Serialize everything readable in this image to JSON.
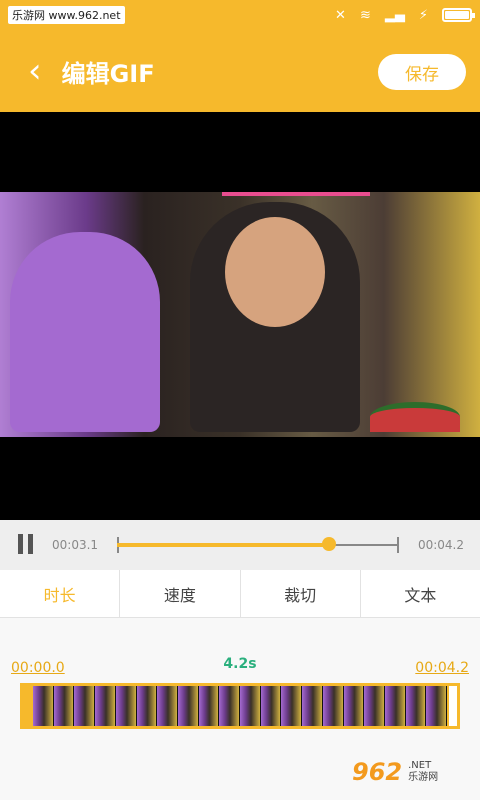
{
  "statusbar": {
    "watermark": "乐游网 www.962.net"
  },
  "header": {
    "back_icon": "‹",
    "title": "编辑GIF",
    "save_label": "保存"
  },
  "player": {
    "current_time": "00:03.1",
    "end_time": "00:04.2",
    "progress": 0.75
  },
  "tabs": [
    {
      "label": "时长",
      "active": true
    },
    {
      "label": "速度",
      "active": false
    },
    {
      "label": "裁切",
      "active": false
    },
    {
      "label": "文本",
      "active": false
    }
  ],
  "duration_panel": {
    "start": "00:00.0",
    "duration": "4.2s",
    "end": "00:04.2"
  },
  "logo": {
    "number": "962",
    "domain": ".NET",
    "name": "乐游网"
  },
  "colors": {
    "accent": "#f6b92c",
    "duration_text": "#2bb07e"
  }
}
